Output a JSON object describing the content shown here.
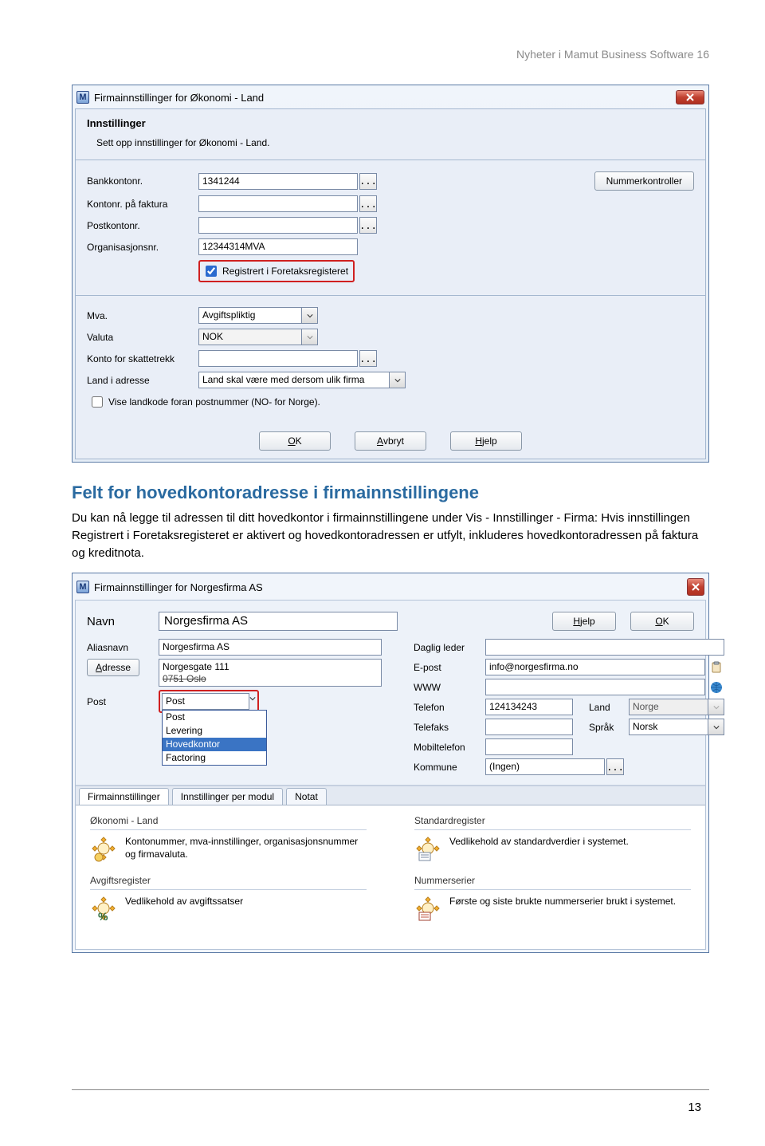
{
  "page_header": "Nyheter i Mamut Business Software 16",
  "page_number": "13",
  "win1": {
    "title": "Firmainnstillinger for Økonomi - Land",
    "intro_title": "Innstillinger",
    "intro_sub": "Sett opp innstillinger for Økonomi - Land.",
    "labels": {
      "bank": "Bankkontonr.",
      "invoice": "Kontonr. på faktura",
      "post": "Postkontonr.",
      "org": "Organisasjonsnr.",
      "registered": "Registrert i Foretaksregisteret",
      "mva": "Mva.",
      "valuta": "Valuta",
      "skatt": "Konto for skattetrekk",
      "land": "Land i adresse",
      "landkode": "Vise landkode foran postnummer (NO- for Norge)."
    },
    "values": {
      "bank": "1341244",
      "invoice": "",
      "post": "",
      "org": "12344314MVA",
      "mva": "Avgiftspliktig",
      "valuta": "NOK",
      "land": "Land skal være med dersom ulik firma"
    },
    "buttons": {
      "nummer": "Nummerkontroller",
      "ok": "OK",
      "avbryt": "Avbryt",
      "hjelp": "Hjelp"
    },
    "picker": "..."
  },
  "heading": "Felt for hovedkontoradresse i firmainnstillingene",
  "body_text": "Du kan nå legge til adressen til ditt hovedkontor i firmainnstillingene under Vis - Innstillinger - Firma: Hvis innstillingen Registrert i Foretaksregisteret er aktivert og hovedkontoradressen er utfylt, inkluderes hovedkontoradressen på faktura og kreditnota.",
  "win2": {
    "title": "Firmainnstillinger for Norgesfirma AS",
    "navn_label": "Navn",
    "navn_value": "Norgesfirma AS",
    "buttons": {
      "hjelp": "Hjelp",
      "ok": "OK",
      "adresse": "Adresse"
    },
    "left": {
      "alias_label": "Aliasnavn",
      "alias_value": "Norgesfirma AS",
      "addr_line1": "Norgesgate 111",
      "addr_line2": "0751 Oslo",
      "post_label": "Post",
      "post_value": "Post",
      "dropdown": {
        "o1": "Post",
        "o2": "Levering",
        "o3": "Hovedkontor",
        "o4": "Factoring"
      }
    },
    "right": {
      "leader_label": "Daglig leder",
      "leader_value": "",
      "email_label": "E-post",
      "email_value": "info@norgesfirma.no",
      "www_label": "WWW",
      "www_value": "",
      "tel_label": "Telefon",
      "tel_value": "124134243",
      "fax_label": "Telefaks",
      "fax_value": "",
      "mob_label": "Mobiltelefon",
      "mob_value": "",
      "kom_label": "Kommune",
      "kom_value": "(Ingen)",
      "land_label": "Land",
      "land_value": "Norge",
      "sprak_label": "Språk",
      "sprak_value": "Norsk"
    },
    "tabs": {
      "t1": "Firmainnstillinger",
      "t2": "Innstillinger per modul",
      "t3": "Notat"
    },
    "panel": {
      "g1": "Økonomi - Land",
      "g1_text": "Kontonummer, mva-innstillinger, organisasjonsnummer og firmavaluta.",
      "g2": "Avgiftsregister",
      "g2_text": "Vedlikehold av avgiftssatser",
      "g3": "Standardregister",
      "g3_text": "Vedlikehold av standardverdier i systemet.",
      "g4": "Nummerserier",
      "g4_text": "Første og siste brukte nummerserier brukt i systemet."
    },
    "picker": "..."
  }
}
